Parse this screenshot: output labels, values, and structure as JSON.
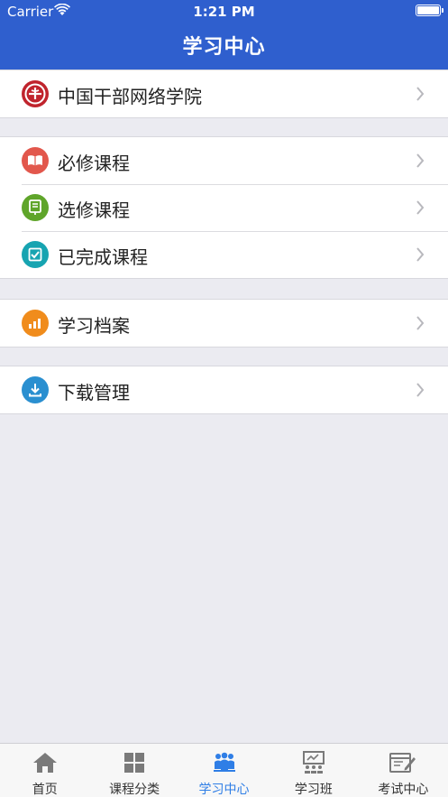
{
  "status_bar": {
    "carrier": "Carrier",
    "time": "1:21 PM"
  },
  "nav": {
    "title": "学习中心"
  },
  "groups": [
    {
      "items": [
        {
          "label": "中国干部网络学院",
          "icon": "college-logo-icon"
        }
      ]
    },
    {
      "items": [
        {
          "label": "必修课程",
          "icon": "book-icon"
        },
        {
          "label": "选修课程",
          "icon": "elective-icon"
        },
        {
          "label": "已完成课程",
          "icon": "completed-check-icon"
        }
      ]
    },
    {
      "items": [
        {
          "label": "学习档案",
          "icon": "chart-icon"
        }
      ]
    },
    {
      "items": [
        {
          "label": "下载管理",
          "icon": "download-icon"
        }
      ]
    }
  ],
  "tabbar": {
    "tabs": [
      {
        "label": "首页",
        "icon": "home-icon"
      },
      {
        "label": "课程分类",
        "icon": "grid-icon"
      },
      {
        "label": "学习中心",
        "icon": "people-icon",
        "active": true
      },
      {
        "label": "学习班",
        "icon": "classroom-icon"
      },
      {
        "label": "考试中心",
        "icon": "exam-icon"
      }
    ]
  },
  "colors": {
    "nav_bar": "#2f5fce",
    "active_tab": "#2f7ee6",
    "book_icon": "#e2574c",
    "elective_icon": "#5fa52a",
    "completed_icon": "#17a4b1",
    "chart_icon": "#f08c1c",
    "download_icon": "#2a8fd0"
  }
}
